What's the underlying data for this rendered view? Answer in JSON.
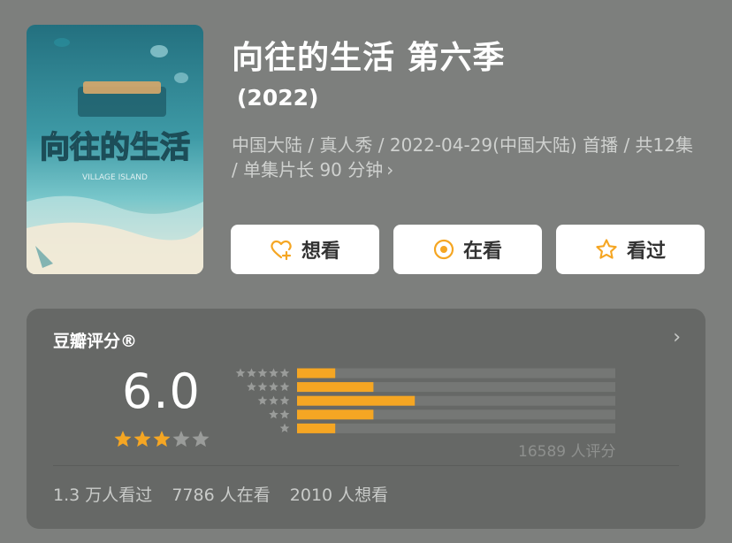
{
  "header": {
    "title": "向往的生活 第六季",
    "year": "(2022)",
    "meta": "中国大陆 / 真人秀 / 2022-04-29(中国大陆) 首播 / 共12集 / 单集片长 90 分钟"
  },
  "poster": {
    "title_text": "向往的生活",
    "subtitle_text": "VILLAGE ISLAND"
  },
  "actions": {
    "want": "想看",
    "watching": "在看",
    "watched": "看过"
  },
  "rating": {
    "title": "豆瓣评分®",
    "score": "6.0",
    "stars": 3,
    "distribution": [
      0.12,
      0.24,
      0.37,
      0.24,
      0.12
    ],
    "count_label": "16589 人评分"
  },
  "stats": {
    "watched": "1.3 万人看过",
    "watching": "7786 人在看",
    "want": "2010 人想看"
  },
  "colors": {
    "background": "#7d7f7d",
    "card": "#666866",
    "accent": "#f5a623",
    "track": "#757775",
    "star_gray": "#9a9c9a"
  }
}
